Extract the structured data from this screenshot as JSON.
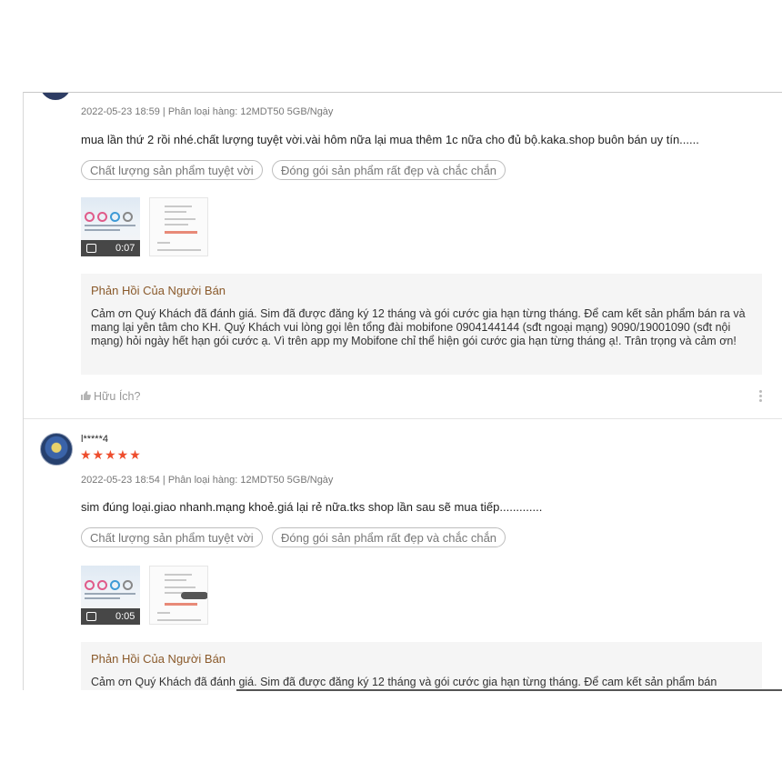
{
  "review1": {
    "meta": "2022-05-23 18:59 | Phân loại hàng: 12MDT50 5GB/Ngày",
    "comment": "mua lần thứ 2 rồi nhé.chất lượng tuyệt vời.vài hôm nữa lại mua thêm 1c nữa cho đủ bộ.kaka.shop buôn bán uy tín......",
    "tags": [
      "Chất lượng sản phẩm tuyệt vời",
      "Đóng gói sản phẩm rất đẹp và chắc chắn"
    ],
    "video_duration": "0:07",
    "reply_title": "Phản Hồi Của Người Bán",
    "reply_text": "Cảm ơn Quý Khách đã đánh giá. Sim đã được đăng ký 12 tháng và gói cước gia hạn từng tháng. Để cam kết sản phẩm bán ra và mang lại yên tâm cho KH. Quý Khách vui lòng gọi lên tổng đài mobifone 0904144144 (sđt ngoại mạng) 9090/19001090 (sđt nội mạng) hỏi ngày hết hạn gói cước ạ. Vì trên app my Mobifone chỉ thể hiện gói cước gia hạn từng tháng ạ!. Trân trọng và cảm ơn!",
    "helpful_label": "Hữu Ích?"
  },
  "review2": {
    "username": "l*****4",
    "rating": 5,
    "stars": "★★★★★",
    "meta": "2022-05-23 18:54 | Phân loại hàng: 12MDT50 5GB/Ngày",
    "comment": "sim đúng loại.giao nhanh.mạng khoẻ.giá lại rẻ nữa.tks shop lần sau sẽ mua tiếp.............",
    "tags": [
      "Chất lượng sản phẩm tuyệt vời",
      "Đóng gói sản phẩm rất đẹp và chắc chắn"
    ],
    "video_duration": "0:05",
    "reply_title": "Phản Hồi Của Người Bán",
    "reply_text": "Cảm ơn Quý Khách đã đánh giá. Sim đã được đăng ký 12 tháng và gói cước gia hạn từng tháng. Để cam kết sản phẩm bán"
  },
  "colors": {
    "star": "#ee4d2d",
    "reply_title": "#8a5a2b",
    "reply_bg": "#f5f5f5"
  },
  "icons": [
    "video-camera-icon",
    "thumbs-up-icon",
    "more-options-icon",
    "avatar"
  ]
}
